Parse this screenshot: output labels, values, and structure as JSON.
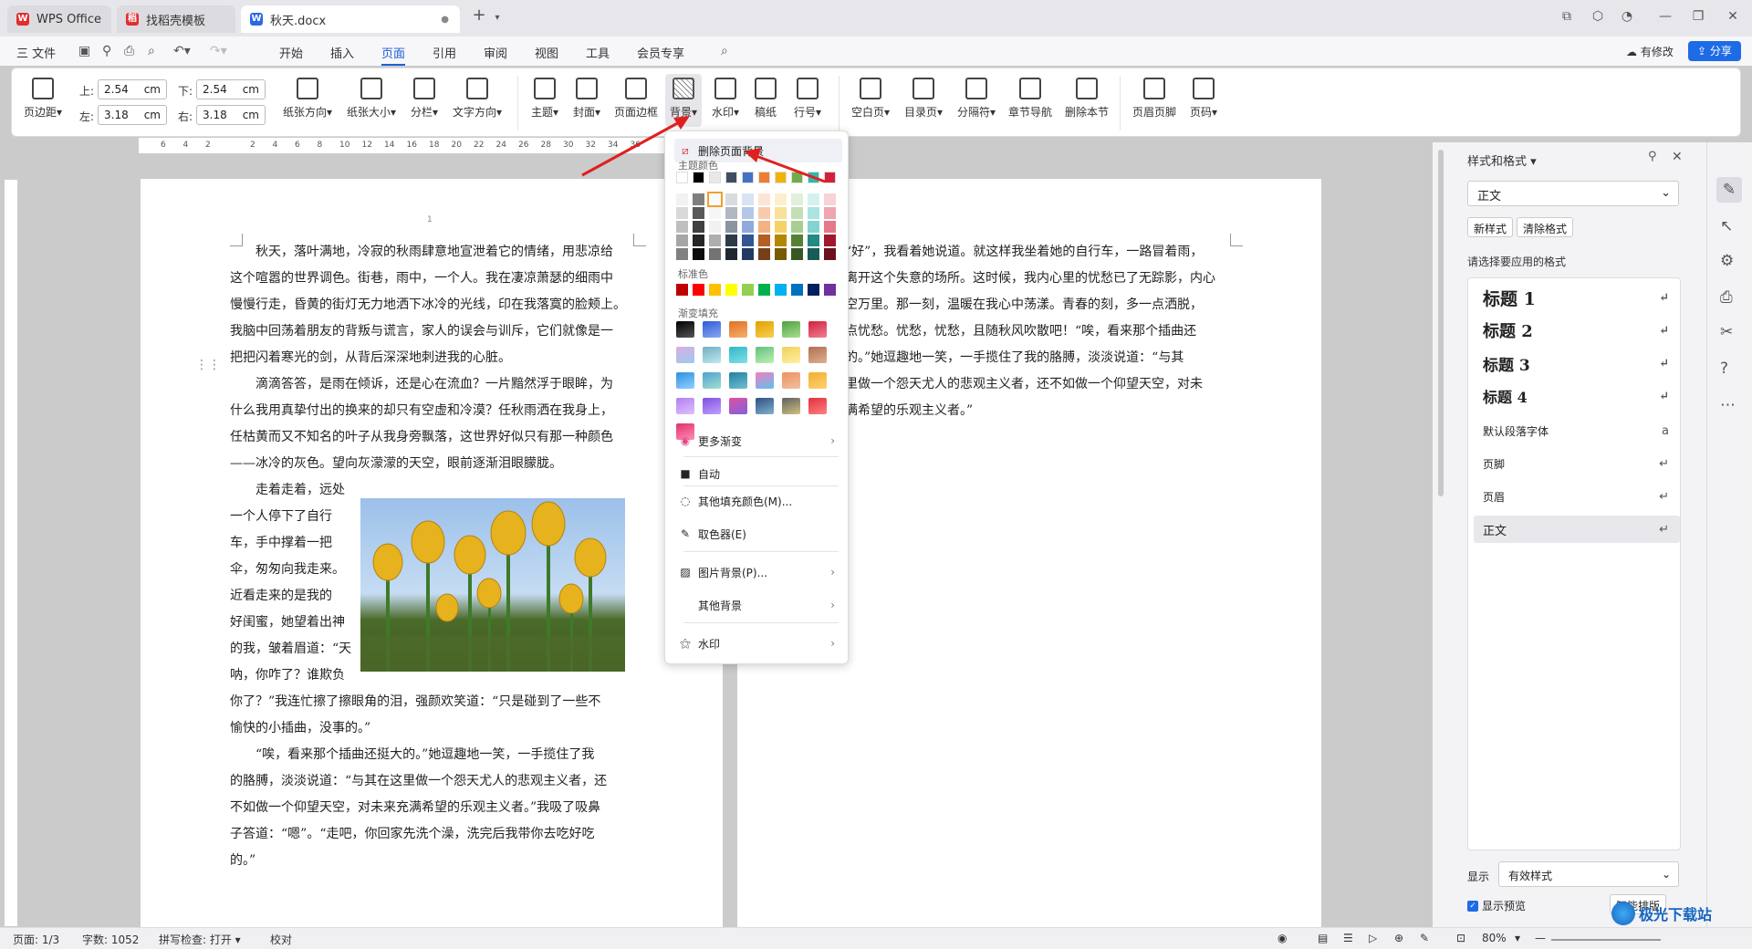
{
  "titlebar": {
    "tabs": [
      {
        "label": "WPS Office",
        "icon": "wps-logo-icon",
        "color": "#e02e2e"
      },
      {
        "label": "找稻壳模板",
        "icon": "docer-icon",
        "color": "#e02e2e"
      },
      {
        "label": "秋天.docx",
        "icon": "word-doc-icon",
        "color": "#2b6ae0"
      }
    ],
    "add_tab": "+"
  },
  "menubar": {
    "file": "三 文件",
    "items": [
      "开始",
      "插入",
      "页面",
      "引用",
      "审阅",
      "视图",
      "工具",
      "会员专享"
    ],
    "active": "页面",
    "revise": "有修改",
    "share": "分享"
  },
  "ribbon": {
    "margin_label": "页边距",
    "top_label": "上:",
    "top_value": "2.54",
    "bottom_label": "下:",
    "bottom_value": "2.54",
    "left_label": "左:",
    "left_value": "3.18",
    "right_label": "右:",
    "right_value": "3.18",
    "unit": "cm",
    "buttons": [
      "纸张方向",
      "纸张大小",
      "分栏",
      "文字方向",
      "主题",
      "封面",
      "页面边框",
      "背景",
      "水印",
      "稿纸",
      "行号",
      "空白页",
      "目录页",
      "分隔符",
      "章节导航",
      "删除本节",
      "页眉页脚",
      "页码"
    ]
  },
  "ruler": {
    "ticks": [
      "6",
      "4",
      "2",
      "",
      "2",
      "4",
      "6",
      "8",
      "10",
      "12",
      "14",
      "16",
      "18",
      "20",
      "22",
      "24",
      "26",
      "28",
      "30",
      "32",
      "34",
      "36"
    ]
  },
  "document": {
    "page_number": "1",
    "left_paragraphs": [
      "　　秋天，落叶满地，冷寂的秋雨肆意地宣泄着它的情绪，用悲凉给",
      "这个喧嚣的世界调色。街巷，雨中，一个人。我在凄凉萧瑟的细雨中",
      "慢慢行走，昏黄的街灯无力地洒下冰冷的光线，印在我落寞的脸颊上。",
      "我脑中回荡着朋友的背叛与谎言，家人的误会与训斥，它们就像是一",
      "把把闪着寒光的剑，从背后深深地刺进我的心脏。",
      "　　滴滴答答，是雨在倾诉，还是心在流血？一片黯然浮于眼眸，为",
      "什么我用真挚付出的换来的却只有空虚和冷漠？任秋雨洒在我身上，",
      "任枯黄而又不知名的叶子从我身旁飘落，这世界好似只有那一种颜色",
      "——冰冷的灰色。望向灰濛濛的天空，眼前逐渐泪眼朦胧。"
    ],
    "wrap_lines": [
      "　　走着走着，远处",
      "一个人停下了自行",
      "车，手中撑着一把",
      "伞，匆匆向我走来。",
      "近看走来的是我的",
      "好闺蜜，她望着出神",
      "的我，皱着眉道：“天",
      "呐，你咋了？谁欺负"
    ],
    "after_lines": [
      "你了？”我连忙擦了擦眼角的泪，强颜欢笑道：“只是碰到了一些不",
      "愉快的小插曲，没事的。”",
      "　　“唉，看来那个插曲还挺大的。”她逗趣地一笑，一手揽住了我",
      "的胳膊，淡淡说道：“与其在这里做一个怨天尤人的悲观主义者，还",
      "不如做一个仰望天空，对未来充满希望的乐观主义者。”我吸了吸鼻",
      "子答道：“嗯”。“走吧，你回家先洗个澡，洗完后我带你去吃好吃",
      "的。”"
    ],
    "right_lines": [
      "“好”，我看着她说道。就这样我坐着她的自行车，一路冒着雨，",
      "离开这个失意的场所。这时候，我内心里的忧愁已了无踪影，内心",
      "空万里。那一刻，温暖在我心中荡漾。青春的刻，多一点洒脱，",
      "点忧愁。忧愁，忧愁，且随秋风吹散吧！“唉，看来那个插曲还",
      "的。”她逗趣地一笑，一手揽住了我的胳膊，淡淡说道：“与其",
      "里做一个怨天尤人的悲观主义者，还不如做一个仰望天空，对未",
      "满希望的乐观主义者。”"
    ]
  },
  "dropdown": {
    "remove_bg": "删除页面背景",
    "theme_colors_label": "主题颜色",
    "standard_label": "标准色",
    "gradient_label": "渐变填充",
    "more_gradient": "更多渐变",
    "auto": "自动",
    "other_fill": "其他填充颜色(M)...",
    "picker": "取色器(E)",
    "picture_bg": "图片背景(P)...",
    "other_bg": "其他背景",
    "watermark": "水印",
    "theme_top": [
      "#ffffff",
      "#000000",
      "#e7e6e6",
      "#44546a",
      "#4472c4",
      "#ed7d31",
      "#a5a5a5",
      "#ffc000",
      "#5b9bd5",
      "#70ad47"
    ],
    "theme_row_top": [
      "#ffffff",
      "#000000",
      "#e8e8e8",
      "#3f4d60",
      "#4472c4",
      "#ed7d31",
      "#f0b400",
      "#70ad47",
      "#2fb8b0",
      "#d6203a"
    ],
    "standard": [
      "#c00000",
      "#ff0000",
      "#ffc000",
      "#ffff00",
      "#92d050",
      "#00b050",
      "#00b0f0",
      "#0070c0",
      "#002060",
      "#7030a0"
    ]
  },
  "panel": {
    "title": "样式和格式",
    "current": "正文",
    "new_style": "新样式",
    "clear_format": "清除格式",
    "prompt": "请选择要应用的格式",
    "styles": [
      "标题 1",
      "标题 2",
      "标题 3",
      "标题 4",
      "默认段落字体",
      "页脚",
      "页眉",
      "正文"
    ],
    "show_label": "显示",
    "show_value": "有效样式",
    "preview": "显示预览",
    "smart": "智能排版"
  },
  "statusbar": {
    "page": "页面: 1/3",
    "words": "字数: 1052",
    "spell": "拼写检查: 打开",
    "proof": "校对",
    "zoom": "80%"
  },
  "watermark_text": "极光下载站"
}
